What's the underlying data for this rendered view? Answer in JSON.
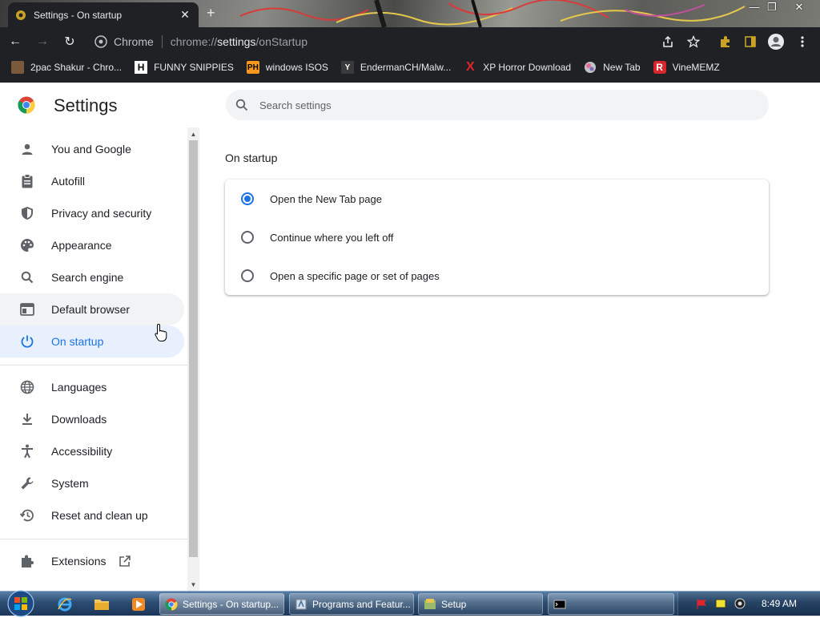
{
  "window": {
    "tab_title": "Settings - On startup",
    "tab_close": "✕",
    "new_tab": "+",
    "minimize": "—",
    "restore": "❐",
    "close": "✕"
  },
  "toolbar": {
    "back": "←",
    "forward": "→",
    "reload": "↻",
    "site_chip": "Chrome",
    "url_prefix": "chrome://",
    "url_host": "settings",
    "url_path": "/onStartup"
  },
  "bookmarks": [
    {
      "label": "2pac Shakur - Chro...",
      "icon": "photo-icon"
    },
    {
      "label": "FUNNY SNIPPIES",
      "icon": "h-letter-icon"
    },
    {
      "label": "windows ISOS",
      "icon": "ph-icon"
    },
    {
      "label": "EndermanCH/Malw...",
      "icon": "yt-icon"
    },
    {
      "label": "XP Horror Download",
      "icon": "x-icon"
    },
    {
      "label": "New Tab",
      "icon": "globe-icon"
    },
    {
      "label": "VineMEMZ",
      "icon": "r-icon"
    }
  ],
  "settings": {
    "title": "Settings",
    "search_placeholder": "Search settings",
    "nav": [
      {
        "label": "You and Google",
        "icon": "person-icon"
      },
      {
        "label": "Autofill",
        "icon": "clipboard-icon"
      },
      {
        "label": "Privacy and security",
        "icon": "shield-icon"
      },
      {
        "label": "Appearance",
        "icon": "palette-icon"
      },
      {
        "label": "Search engine",
        "icon": "search-icon"
      },
      {
        "label": "Default browser",
        "icon": "browser-icon"
      },
      {
        "label": "On startup",
        "icon": "power-icon"
      },
      {
        "label": "Languages",
        "icon": "globe-icon"
      },
      {
        "label": "Downloads",
        "icon": "download-icon"
      },
      {
        "label": "Accessibility",
        "icon": "accessibility-icon"
      },
      {
        "label": "System",
        "icon": "wrench-icon"
      },
      {
        "label": "Reset and clean up",
        "icon": "history-icon"
      },
      {
        "label": "Extensions",
        "icon": "puzzle-icon"
      }
    ],
    "active_nav": "On startup",
    "hover_nav": "Default browser",
    "section_title": "On startup",
    "startup_options": [
      {
        "label": "Open the New Tab page",
        "checked": true
      },
      {
        "label": "Continue where you left off",
        "checked": false
      },
      {
        "label": "Open a specific page or set of pages",
        "checked": false
      }
    ]
  },
  "taskbar": {
    "items": [
      {
        "label": "Settings - On startup...",
        "active": true
      },
      {
        "label": "Programs and Featur...",
        "active": false
      },
      {
        "label": "Setup",
        "active": false
      },
      {
        "label": "",
        "active": false
      }
    ],
    "clock": "8:49 AM"
  },
  "colors": {
    "accent": "#1a73e8",
    "chrome_dark": "#202124",
    "active_nav_bg": "#e8f0fe"
  }
}
